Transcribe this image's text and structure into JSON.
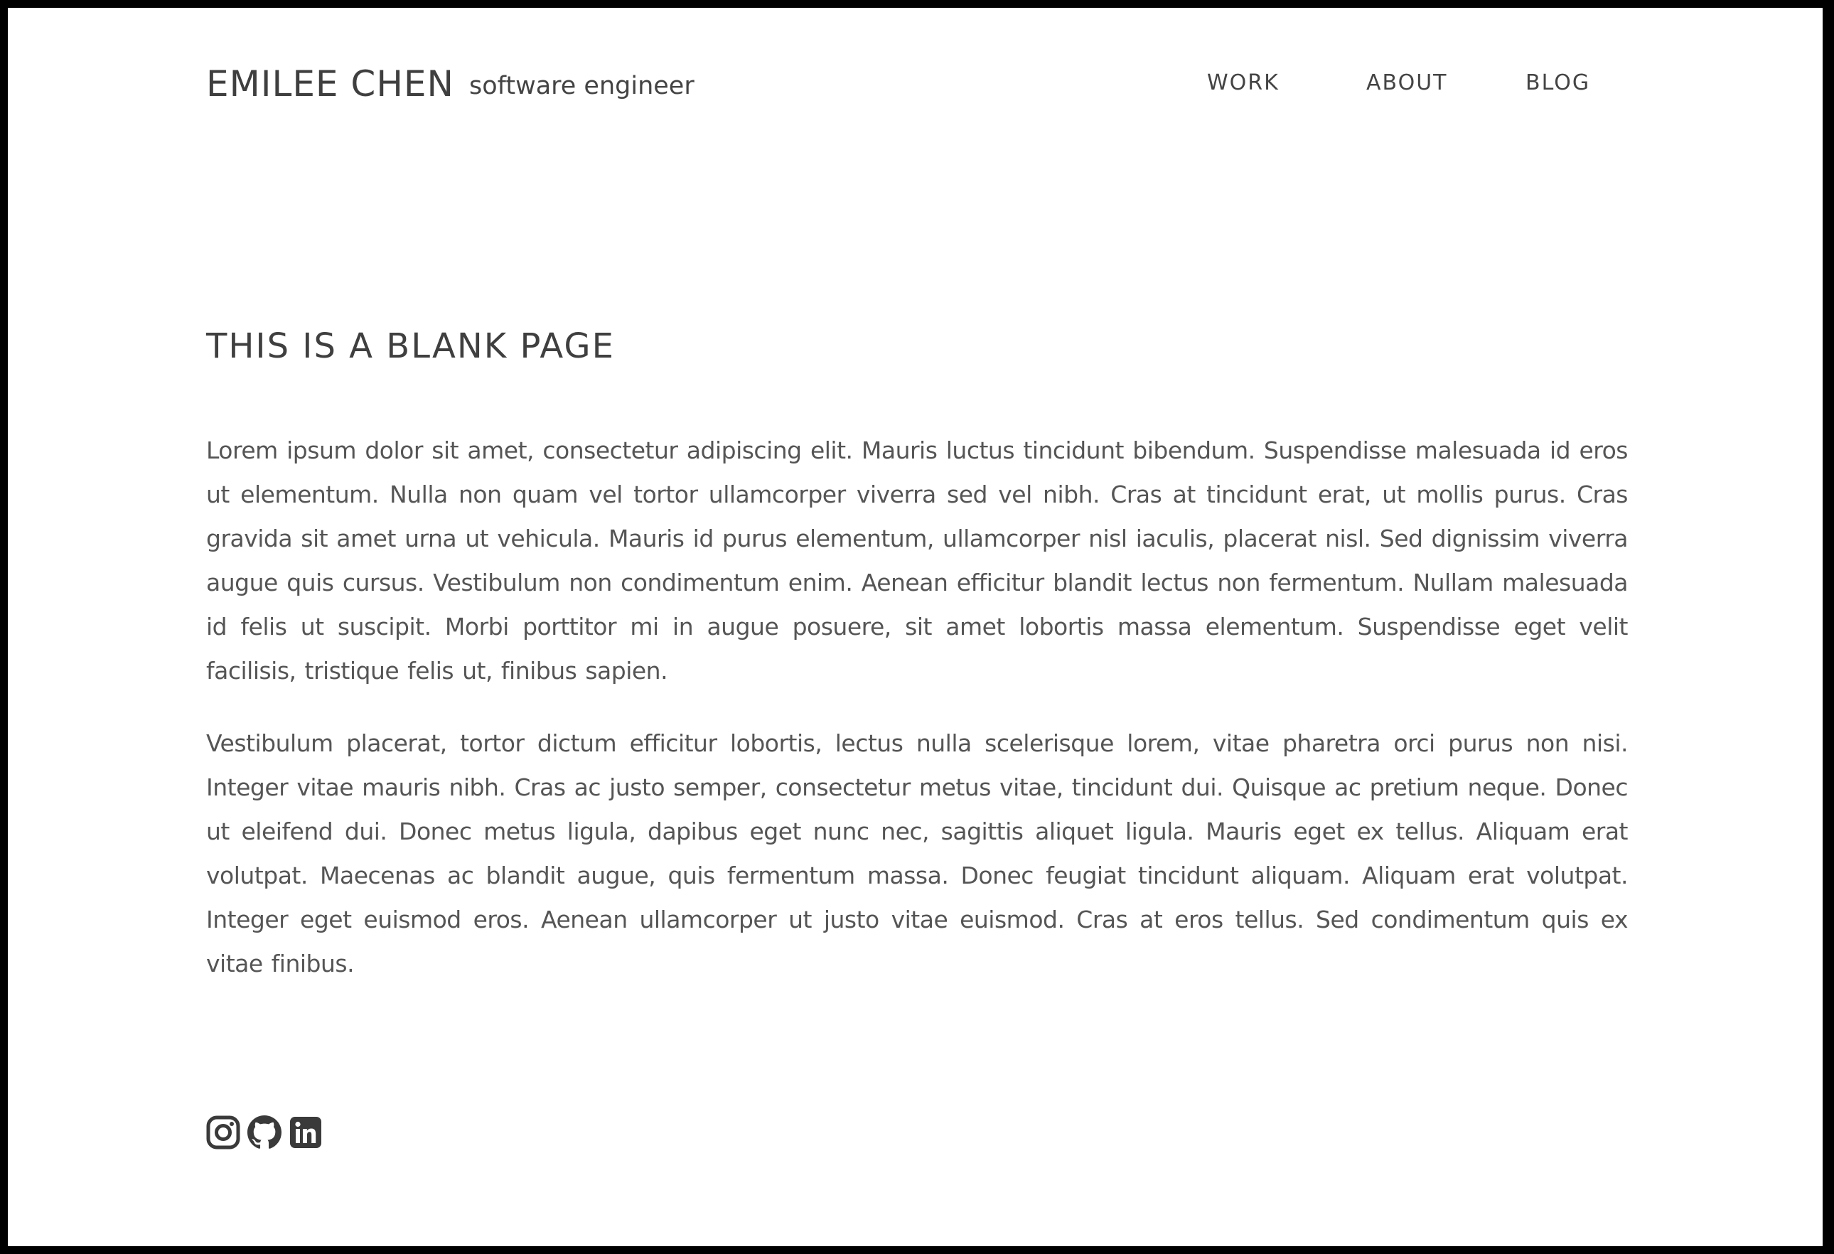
{
  "header": {
    "name": "EMILEE CHEN",
    "tagline": "software engineer",
    "nav": [
      {
        "label": "WORK"
      },
      {
        "label": "ABOUT"
      },
      {
        "label": "BLOG"
      }
    ]
  },
  "main": {
    "title": "THIS IS A BLANK PAGE",
    "paragraphs": [
      "Lorem ipsum dolor sit amet, consectetur adipiscing elit. Mauris luctus tincidunt bibendum. Suspendisse malesuada id eros ut elementum. Nulla non quam vel tortor ullamcorper viverra sed vel nibh. Cras at tincidunt erat, ut mollis purus. Cras gravida sit amet urna ut vehicula. Mauris id purus elementum, ullamcorper nisl iaculis, placerat nisl. Sed dignissim viverra augue quis cursus. Vestibulum non condimentum enim. Aenean efficitur blandit lectus non fermentum. Nullam malesuada id felis ut suscipit. Morbi porttitor mi in augue posuere, sit amet lobortis massa elementum. Suspendisse eget velit facilisis, tristique felis ut, finibus sapien.",
      "Vestibulum placerat, tortor dictum efficitur lobortis, lectus nulla scelerisque lorem, vitae pharetra orci purus non nisi. Integer vitae mauris nibh. Cras ac justo semper, consectetur metus vitae, tincidunt dui. Quisque ac pretium neque. Donec ut eleifend dui. Donec metus ligula, dapibus eget nunc nec, sagittis aliquet ligula. Mauris eget ex tellus. Aliquam erat volutpat. Maecenas ac blandit augue, quis fermentum massa. Donec feugiat tincidunt aliquam. Aliquam erat volutpat. Integer eget euismod eros. Aenean ullamcorper ut justo vitae euismod. Cras at eros tellus. Sed condimentum quis ex vitae finibus."
    ]
  },
  "footer": {
    "social": [
      {
        "icon": "instagram-icon"
      },
      {
        "icon": "github-icon"
      },
      {
        "icon": "linkedin-icon"
      }
    ]
  },
  "colors": {
    "frame": "#000000",
    "background": "#ffffff",
    "heading": "#3f3f3f",
    "body_text": "#555555"
  }
}
